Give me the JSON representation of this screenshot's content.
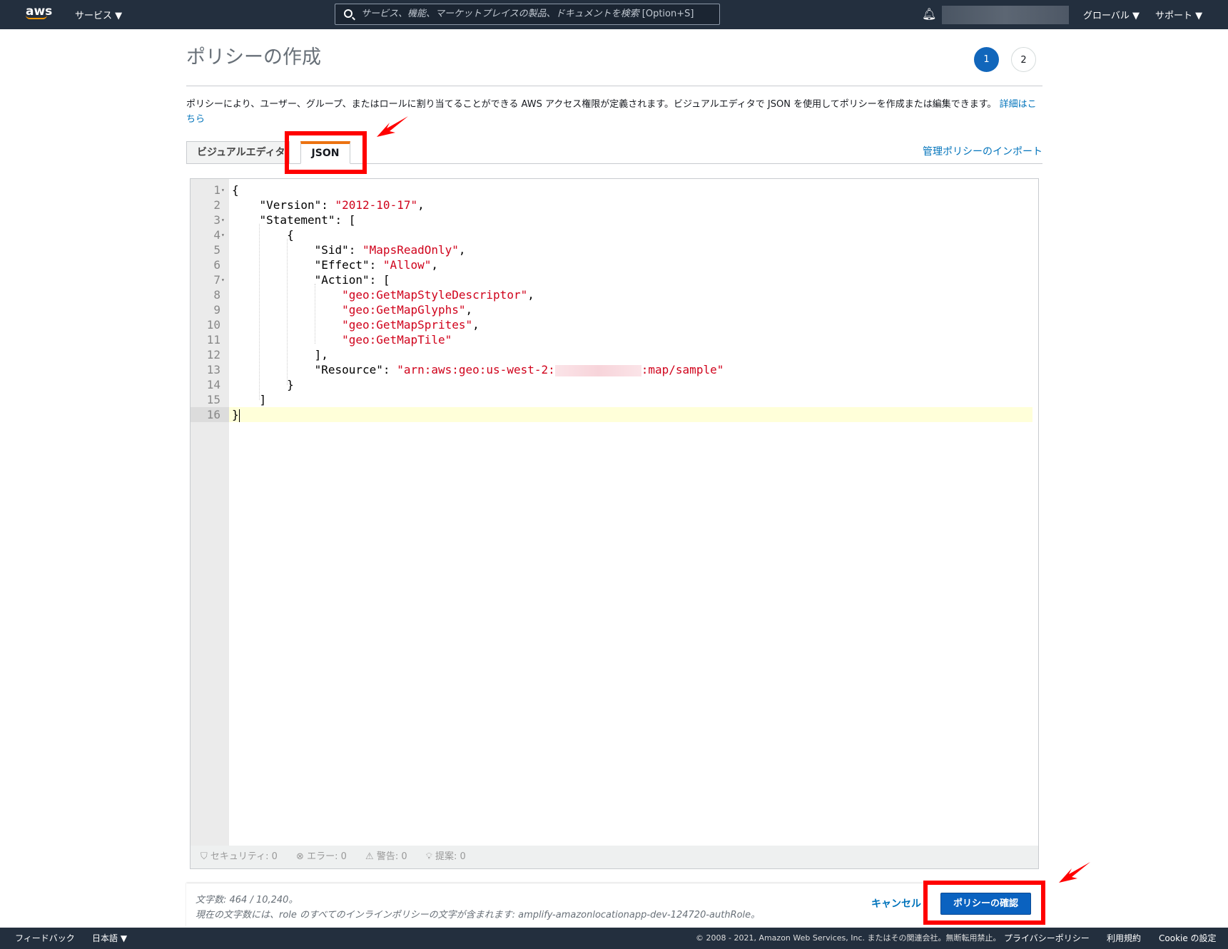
{
  "nav": {
    "logo": "aws",
    "services": "サービス ▼",
    "search_placeholder": "サービス、機能、マーケットプレイスの製品、ドキュメントを検索",
    "search_shortcut": "[Option+S]",
    "icon_bell": "bell-icon",
    "global": "グローバル ▼",
    "support": "サポート ▼"
  },
  "page": {
    "title": "ポリシーの作成",
    "steps": [
      "1",
      "2"
    ],
    "current_step": 1,
    "description": "ポリシーにより、ユーザー、グループ、またはロールに割り当てることができる AWS アクセス権限が定義されます。ビジュアルエディタで JSON を使用してポリシーを作成または編集できます。",
    "learn_more": "詳細はこちら"
  },
  "tabs": [
    {
      "label": "ビジュアルエディタ"
    },
    {
      "label": "JSON",
      "active": true
    }
  ],
  "import_link": "管理ポリシーのインポート",
  "editor": {
    "lines": [
      {
        "n": "1",
        "fold": true,
        "t": "{"
      },
      {
        "n": "2",
        "t": "    \"Version\": ",
        "s": "\"2012-10-17\"",
        "e": ","
      },
      {
        "n": "3",
        "fold": true,
        "t": "    \"Statement\": ["
      },
      {
        "n": "4",
        "fold": true,
        "t": "        {"
      },
      {
        "n": "5",
        "t": "            \"Sid\": ",
        "s": "\"MapsReadOnly\"",
        "e": ","
      },
      {
        "n": "6",
        "t": "            \"Effect\": ",
        "s": "\"Allow\"",
        "e": ","
      },
      {
        "n": "7",
        "fold": true,
        "t": "            \"Action\": ["
      },
      {
        "n": "8",
        "t": "                ",
        "s": "\"geo:GetMapStyleDescriptor\"",
        "e": ","
      },
      {
        "n": "9",
        "t": "                ",
        "s": "\"geo:GetMapGlyphs\"",
        "e": ","
      },
      {
        "n": "10",
        "t": "                ",
        "s": "\"geo:GetMapSprites\"",
        "e": ","
      },
      {
        "n": "11",
        "t": "                ",
        "s": "\"geo:GetMapTile\"",
        "e": ""
      },
      {
        "n": "12",
        "t": "            ],"
      },
      {
        "n": "13",
        "t": "            \"Resource\": ",
        "s": "\"arn:aws:geo:us-west-2:",
        "redact": true,
        "s2": ":map/sample\"",
        "e": ""
      },
      {
        "n": "14",
        "t": "        }"
      },
      {
        "n": "15",
        "t": "    ]"
      },
      {
        "n": "16",
        "t": "}",
        "active": true
      }
    ]
  },
  "status": {
    "security": "セキュリティ: 0",
    "errors": "エラー: 0",
    "warnings": "警告: 0",
    "suggestions": "提案: 0"
  },
  "footer_panel": {
    "char_count": "文字数: 464 / 10,240。",
    "note": "現在の文字数には、role のすべてのインラインポリシーの文字が含まれます: amplify-amazonlocationapp-dev-124720-authRole。",
    "cancel": "キャンセル",
    "review": "ポリシーの確認"
  },
  "bottom": {
    "feedback": "フィードバック",
    "language": "日本語 ▼",
    "copyright": "© 2008 - 2021, Amazon Web Services, Inc. またはその関連会社。無断転用禁止。",
    "privacy": "プライバシーポリシー",
    "terms": "利用規約",
    "cookie": "Cookie の設定"
  },
  "colors": {
    "nav_bg": "#232f3e",
    "accent": "#ec7211",
    "primary": "#0a62c0",
    "string": "#d0021b",
    "annotation": "#ff0000"
  }
}
